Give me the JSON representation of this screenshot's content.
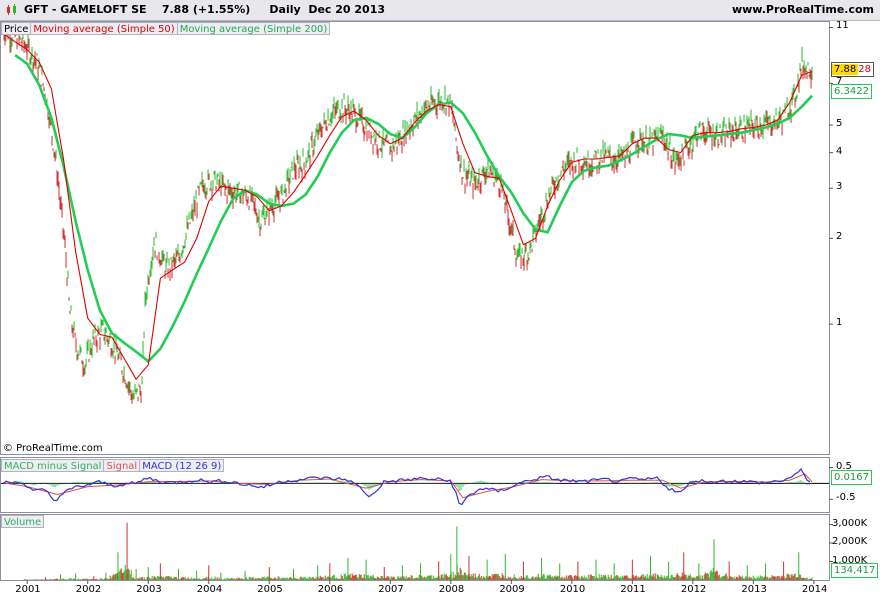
{
  "header": {
    "title": "GFT - GAMELOFT SE    7.88 (+1.55%)     Daily  Dec 20 2013",
    "site": "www.ProRealTime.com"
  },
  "copyright": "© ProRealTime.com",
  "colors": {
    "price_up": "#2eb82e",
    "price_down": "#d03030",
    "ma50": "#e00000",
    "ma200": "#22cc55",
    "macd": "#3333cc",
    "signal": "#e05050",
    "histogram": "#30c060",
    "grid_border": "#9090a0"
  },
  "legends": {
    "price": [
      {
        "label": "Price",
        "color": "#000000"
      },
      {
        "label": "Moving average (Simple 50)",
        "color": "#e00000"
      },
      {
        "label": "Moving average (Simple 200)",
        "color": "#22aa55"
      }
    ],
    "macd": [
      {
        "label": "MACD minus Signal",
        "color": "#30b060"
      },
      {
        "label": "Signal",
        "color": "#e05050"
      },
      {
        "label": "MACD (12 26 9)",
        "color": "#3333cc"
      }
    ],
    "volume": [
      {
        "label": "Volume",
        "color": "#30b060"
      }
    ]
  },
  "badges": {
    "price_last": "7.88",
    "price_last_suffix": "28",
    "ma200_last": "6.3422",
    "macd_last": "0.0167",
    "volume_last": "134,417"
  },
  "chart_data": [
    {
      "type": "line",
      "title": "GFT - GAMELOFT SE",
      "panel": "price",
      "yscale": "log",
      "yticks": [
        "11",
        "7",
        "5",
        "4",
        "3",
        "2",
        "1"
      ],
      "ylim": [
        0.35,
        11.5
      ],
      "xticks": [
        "2001",
        "2002",
        "2003",
        "2004",
        "2005",
        "2006",
        "2007",
        "2008",
        "2009",
        "2010",
        "2011",
        "2012",
        "2013",
        "2014"
      ],
      "xlim": [
        2000.55,
        2014.25
      ],
      "series": [
        {
          "name": "Price",
          "x": [
            2000.6,
            2000.8,
            2001.0,
            2001.15,
            2001.3,
            2001.4,
            2001.55,
            2001.7,
            2001.8,
            2001.95,
            2002.1,
            2002.25,
            2002.45,
            2002.6,
            2002.75,
            2002.9,
            2002.95,
            2003.1,
            2003.3,
            2003.5,
            2003.7,
            2003.9,
            2004.1,
            2004.3,
            2004.5,
            2004.7,
            2004.85,
            2005.0,
            2005.2,
            2005.4,
            2005.6,
            2005.8,
            2006.0,
            2006.2,
            2006.4,
            2006.6,
            2006.8,
            2007.0,
            2007.2,
            2007.4,
            2007.6,
            2007.8,
            2007.9,
            2008.0,
            2008.1,
            2008.2,
            2008.4,
            2008.6,
            2008.8,
            2008.95,
            2009.1,
            2009.3,
            2009.5,
            2009.7,
            2009.9,
            2010.1,
            2010.3,
            2010.5,
            2010.7,
            2010.9,
            2011.1,
            2011.3,
            2011.5,
            2011.7,
            2011.9,
            2012.1,
            2012.3,
            2012.5,
            2012.7,
            2012.9,
            2013.1,
            2013.3,
            2013.5,
            2013.7,
            2013.8,
            2013.9,
            2013.97
          ],
          "values": [
            10.8,
            10.2,
            9.4,
            8.4,
            6.5,
            4.8,
            2.6,
            1.1,
            0.85,
            0.72,
            0.88,
            0.95,
            0.82,
            0.68,
            0.55,
            0.6,
            1.2,
            1.95,
            1.55,
            1.7,
            2.3,
            3.1,
            3.2,
            2.95,
            2.9,
            2.75,
            2.3,
            2.55,
            2.8,
            3.5,
            3.7,
            4.6,
            5.4,
            5.8,
            5.5,
            4.9,
            4.4,
            4.1,
            4.6,
            5.2,
            5.8,
            6.1,
            6.2,
            5.9,
            4.2,
            3.4,
            3.1,
            3.5,
            3.2,
            2.4,
            1.7,
            1.8,
            2.4,
            3.1,
            3.6,
            3.8,
            3.7,
            3.9,
            3.8,
            3.9,
            4.5,
            4.3,
            4.6,
            3.7,
            4.1,
            4.8,
            4.7,
            4.6,
            4.8,
            4.9,
            5.0,
            5.1,
            5.3,
            6.4,
            8.2,
            7.9,
            7.88
          ]
        },
        {
          "name": "Moving average (Simple 50)",
          "x": [
            2000.6,
            2000.8,
            2001.0,
            2001.2,
            2001.4,
            2001.6,
            2001.8,
            2002.0,
            2002.2,
            2002.4,
            2002.6,
            2002.8,
            2003.0,
            2003.2,
            2003.4,
            2003.6,
            2003.8,
            2004.0,
            2004.2,
            2004.4,
            2004.6,
            2004.8,
            2005.0,
            2005.2,
            2005.4,
            2005.6,
            2005.8,
            2006.0,
            2006.2,
            2006.4,
            2006.6,
            2006.8,
            2007.0,
            2007.2,
            2007.4,
            2007.6,
            2007.8,
            2008.0,
            2008.2,
            2008.4,
            2008.6,
            2008.8,
            2009.0,
            2009.2,
            2009.4,
            2009.6,
            2009.8,
            2010.0,
            2010.2,
            2010.4,
            2010.6,
            2010.8,
            2011.0,
            2011.2,
            2011.4,
            2011.6,
            2011.8,
            2012.0,
            2012.2,
            2012.4,
            2012.6,
            2012.8,
            2013.0,
            2013.2,
            2013.4,
            2013.6,
            2013.8,
            2013.97
          ],
          "values": [
            10.5,
            9.8,
            9.2,
            8.3,
            6.7,
            3.8,
            1.8,
            1.05,
            0.92,
            0.9,
            0.76,
            0.64,
            0.72,
            1.45,
            1.55,
            1.65,
            2.0,
            2.7,
            3.05,
            3.0,
            2.95,
            2.8,
            2.5,
            2.6,
            2.9,
            3.35,
            3.9,
            4.6,
            5.35,
            5.6,
            5.2,
            4.6,
            4.3,
            4.5,
            5.1,
            5.6,
            5.9,
            5.8,
            4.3,
            3.4,
            3.3,
            3.25,
            2.5,
            1.9,
            2.0,
            2.6,
            3.2,
            3.7,
            3.8,
            3.8,
            3.85,
            3.9,
            4.3,
            4.5,
            4.5,
            4.1,
            4.0,
            4.6,
            4.7,
            4.7,
            4.75,
            4.85,
            4.9,
            5.0,
            5.2,
            6.0,
            7.5,
            7.7
          ]
        },
        {
          "name": "Moving average (Simple 200)",
          "x": [
            2000.8,
            2001.0,
            2001.2,
            2001.4,
            2001.6,
            2001.8,
            2002.0,
            2002.2,
            2002.4,
            2002.6,
            2002.8,
            2003.0,
            2003.2,
            2003.4,
            2003.6,
            2003.8,
            2004.0,
            2004.2,
            2004.4,
            2004.6,
            2004.8,
            2005.0,
            2005.2,
            2005.4,
            2005.6,
            2005.8,
            2006.0,
            2006.2,
            2006.4,
            2006.6,
            2006.8,
            2007.0,
            2007.2,
            2007.4,
            2007.6,
            2007.8,
            2008.0,
            2008.2,
            2008.4,
            2008.6,
            2008.8,
            2009.0,
            2009.2,
            2009.4,
            2009.6,
            2009.8,
            2010.0,
            2010.2,
            2010.4,
            2010.6,
            2010.8,
            2011.0,
            2011.2,
            2011.4,
            2011.6,
            2011.8,
            2012.0,
            2012.2,
            2012.4,
            2012.6,
            2012.8,
            2013.0,
            2013.2,
            2013.4,
            2013.6,
            2013.8,
            2013.97
          ],
          "values": [
            8.8,
            8.2,
            6.9,
            5.3,
            3.6,
            2.3,
            1.55,
            1.12,
            0.93,
            0.86,
            0.8,
            0.74,
            0.82,
            0.98,
            1.2,
            1.5,
            1.85,
            2.3,
            2.75,
            2.95,
            2.85,
            2.65,
            2.6,
            2.65,
            2.85,
            3.3,
            4.0,
            4.7,
            5.2,
            5.3,
            5.05,
            4.65,
            4.5,
            4.9,
            5.5,
            5.9,
            6.0,
            5.5,
            4.7,
            3.9,
            3.3,
            2.9,
            2.45,
            2.15,
            2.1,
            2.6,
            3.15,
            3.45,
            3.55,
            3.6,
            3.75,
            3.95,
            4.2,
            4.45,
            4.65,
            4.6,
            4.5,
            4.55,
            4.6,
            4.65,
            4.7,
            4.8,
            4.9,
            5.05,
            5.3,
            5.8,
            6.34
          ]
        }
      ]
    },
    {
      "type": "line",
      "title": "MACD (12 26 9)",
      "panel": "macd",
      "yticks": [
        "0.5",
        "-0.5"
      ],
      "ylim": [
        -0.9,
        0.8
      ],
      "xlim": [
        2000.55,
        2014.25
      ],
      "series": [
        {
          "name": "MACD (12 26 9)",
          "x": [
            2000.6,
            2000.9,
            2001.1,
            2001.3,
            2001.45,
            2001.6,
            2001.8,
            2002.0,
            2002.2,
            2002.4,
            2002.6,
            2002.8,
            2003.0,
            2003.2,
            2003.4,
            2003.6,
            2003.8,
            2004.0,
            2004.3,
            2004.6,
            2004.9,
            2005.2,
            2005.5,
            2005.8,
            2006.0,
            2006.3,
            2006.55,
            2006.65,
            2006.9,
            2007.2,
            2007.5,
            2007.8,
            2008.0,
            2008.1,
            2008.15,
            2008.25,
            2008.5,
            2008.8,
            2009.0,
            2009.2,
            2009.4,
            2009.6,
            2009.8,
            2010.0,
            2010.2,
            2010.4,
            2010.6,
            2010.8,
            2011.0,
            2011.2,
            2011.4,
            2011.6,
            2011.8,
            2012.0,
            2012.3,
            2012.6,
            2012.9,
            2013.2,
            2013.5,
            2013.7,
            2013.8,
            2013.9,
            2013.97
          ],
          "values": [
            0.02,
            0.05,
            -0.25,
            -0.2,
            -0.55,
            -0.3,
            -0.12,
            -0.05,
            0.05,
            -0.08,
            -0.02,
            0.0,
            0.18,
            0.05,
            0.02,
            0.06,
            0.12,
            0.05,
            0.08,
            -0.04,
            -0.12,
            0.06,
            0.12,
            0.18,
            0.15,
            0.12,
            -0.2,
            -0.45,
            0.05,
            0.1,
            0.15,
            0.12,
            0.08,
            -0.35,
            -0.8,
            -0.45,
            -0.15,
            -0.25,
            -0.1,
            0.05,
            0.15,
            0.2,
            0.1,
            0.08,
            0.05,
            0.1,
            0.12,
            0.05,
            0.15,
            0.1,
            0.18,
            -0.15,
            -0.3,
            0.1,
            0.05,
            0.08,
            0.05,
            0.02,
            0.1,
            0.25,
            0.45,
            0.1,
            0.02
          ]
        },
        {
          "name": "Signal",
          "x": [
            2000.6,
            2001.0,
            2001.5,
            2002.0,
            2002.5,
            2003.0,
            2003.5,
            2004.0,
            2004.5,
            2005.0,
            2005.5,
            2006.0,
            2006.6,
            2007.0,
            2007.5,
            2008.0,
            2008.2,
            2008.6,
            2009.0,
            2009.5,
            2010.0,
            2010.5,
            2011.0,
            2011.5,
            2011.8,
            2012.2,
            2012.7,
            2013.2,
            2013.6,
            2013.85,
            2013.97
          ],
          "values": [
            0.02,
            -0.1,
            -0.35,
            -0.1,
            -0.05,
            0.05,
            0.06,
            0.08,
            0.0,
            -0.02,
            0.1,
            0.14,
            -0.15,
            0.05,
            0.12,
            0.08,
            -0.45,
            -0.25,
            -0.12,
            0.12,
            0.08,
            0.08,
            0.1,
            0.1,
            -0.15,
            0.05,
            0.06,
            0.04,
            0.1,
            0.3,
            0.05
          ]
        }
      ]
    },
    {
      "type": "bar",
      "title": "Volume",
      "panel": "volume",
      "yticks": [
        "3,000K",
        "2,000K",
        "1,000K"
      ],
      "ylim": [
        0,
        3300000
      ],
      "xlim": [
        2000.55,
        2014.25
      ],
      "x": [
        2001.3,
        2001.55,
        2001.8,
        2002.1,
        2002.3,
        2002.5,
        2002.65,
        2002.8,
        2003.0,
        2003.2,
        2003.5,
        2003.8,
        2004.0,
        2004.2,
        2004.6,
        2005.0,
        2005.4,
        2005.8,
        2006.0,
        2006.3,
        2006.6,
        2006.9,
        2007.2,
        2007.5,
        2007.8,
        2008.0,
        2008.1,
        2008.3,
        2008.6,
        2008.9,
        2009.2,
        2009.5,
        2009.8,
        2010.1,
        2010.4,
        2010.7,
        2011.0,
        2011.3,
        2011.6,
        2011.85,
        2012.1,
        2012.35,
        2012.6,
        2012.9,
        2013.2,
        2013.5,
        2013.75,
        2013.97
      ],
      "values": [
        150000,
        300000,
        350000,
        200000,
        400000,
        1500000,
        3100000,
        600000,
        700000,
        900000,
        600000,
        500000,
        800000,
        400000,
        500000,
        700000,
        600000,
        800000,
        900000,
        1200000,
        1100000,
        700000,
        800000,
        900000,
        1000000,
        1400000,
        2900000,
        1300000,
        1100000,
        1400000,
        1000000,
        1200000,
        900000,
        1000000,
        1100000,
        900000,
        1100000,
        1300000,
        1000000,
        1500000,
        900000,
        2200000,
        1000000,
        800000,
        900000,
        1000000,
        1500000,
        134417
      ]
    }
  ]
}
